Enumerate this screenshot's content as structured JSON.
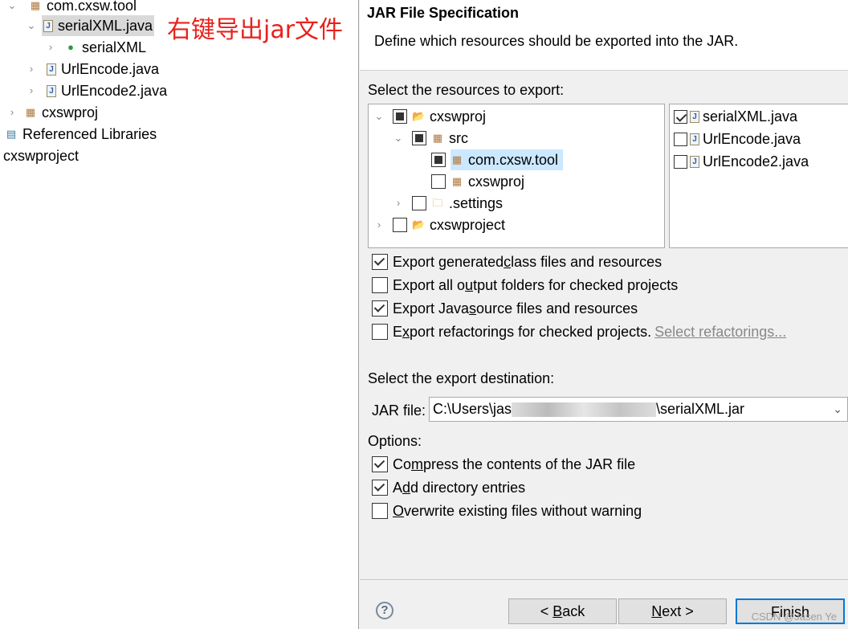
{
  "explorer": {
    "items": [
      {
        "label": "com.cxsw.tool",
        "icon": "package-icon",
        "expanded": true
      },
      {
        "label": "serialXML.java",
        "icon": "java-file-icon",
        "expanded": true,
        "selected": true
      },
      {
        "label": "serialXML",
        "icon": "class-run-icon",
        "expanded": false
      },
      {
        "label": "UrlEncode.java",
        "icon": "java-file-icon",
        "expanded": false
      },
      {
        "label": "UrlEncode2.java",
        "icon": "java-file-icon",
        "expanded": false
      },
      {
        "label": "cxswproj",
        "icon": "package-warning-icon",
        "expanded": false
      },
      {
        "label": "Referenced Libraries",
        "icon": "library-icon"
      },
      {
        "label": "cxswproject"
      }
    ],
    "annotation": "右键导出jar文件"
  },
  "dialog": {
    "title": "JAR File Specification",
    "description": "Define which resources should be exported into the JAR.",
    "resources_label": "Select the resources to export:",
    "resources_label_mnemonic": "e",
    "tree": [
      {
        "label": "cxswproj",
        "state": "partial",
        "expanded": true
      },
      {
        "label": "src",
        "state": "partial",
        "expanded": true
      },
      {
        "label": "com.cxsw.tool",
        "state": "partial",
        "selected": true
      },
      {
        "label": "cxswproj",
        "state": "unchecked"
      },
      {
        "label": ".settings",
        "state": "unchecked",
        "expanded": false
      },
      {
        "label": "cxswproject",
        "state": "unchecked",
        "expanded": false
      }
    ],
    "files": [
      {
        "label": "serialXML.java",
        "checked": true
      },
      {
        "label": "UrlEncode.java",
        "checked": false
      },
      {
        "label": "UrlEncode2.java",
        "checked": false
      }
    ],
    "options1": [
      {
        "pre": "Export generated ",
        "u": "c",
        "post": "lass files and resources",
        "checked": true
      },
      {
        "pre": "Export all o",
        "u": "u",
        "post": "tput folders for checked projects",
        "checked": false
      },
      {
        "pre": "Export Java ",
        "u": "s",
        "post": "ource files and resources",
        "checked": true
      },
      {
        "pre": "E",
        "u": "x",
        "post": "port refactorings for checked projects.",
        "checked": false
      }
    ],
    "select_refactorings": "Select refactorings...",
    "destination_label": "Select the export destination:",
    "jar_label": "JAR file:",
    "jar_path_start": "C:\\Users\\jas",
    "jar_path_end": "\\serialXML.jar",
    "options_label": "Options:",
    "options2": [
      {
        "pre": "Co",
        "u": "m",
        "post": "press the contents of the JAR file",
        "checked": true
      },
      {
        "pre": "A",
        "u": "d",
        "post": "d directory entries",
        "checked": true
      },
      {
        "pre": "",
        "u": "O",
        "post": "verwrite existing files without warning",
        "checked": false
      }
    ],
    "buttons": {
      "back_pre": "< ",
      "back_u": "B",
      "back_post": "ack",
      "next_u": "N",
      "next_post": "ext >",
      "finish": "Finish"
    },
    "watermark": "CSDN @Jasen Ye"
  }
}
